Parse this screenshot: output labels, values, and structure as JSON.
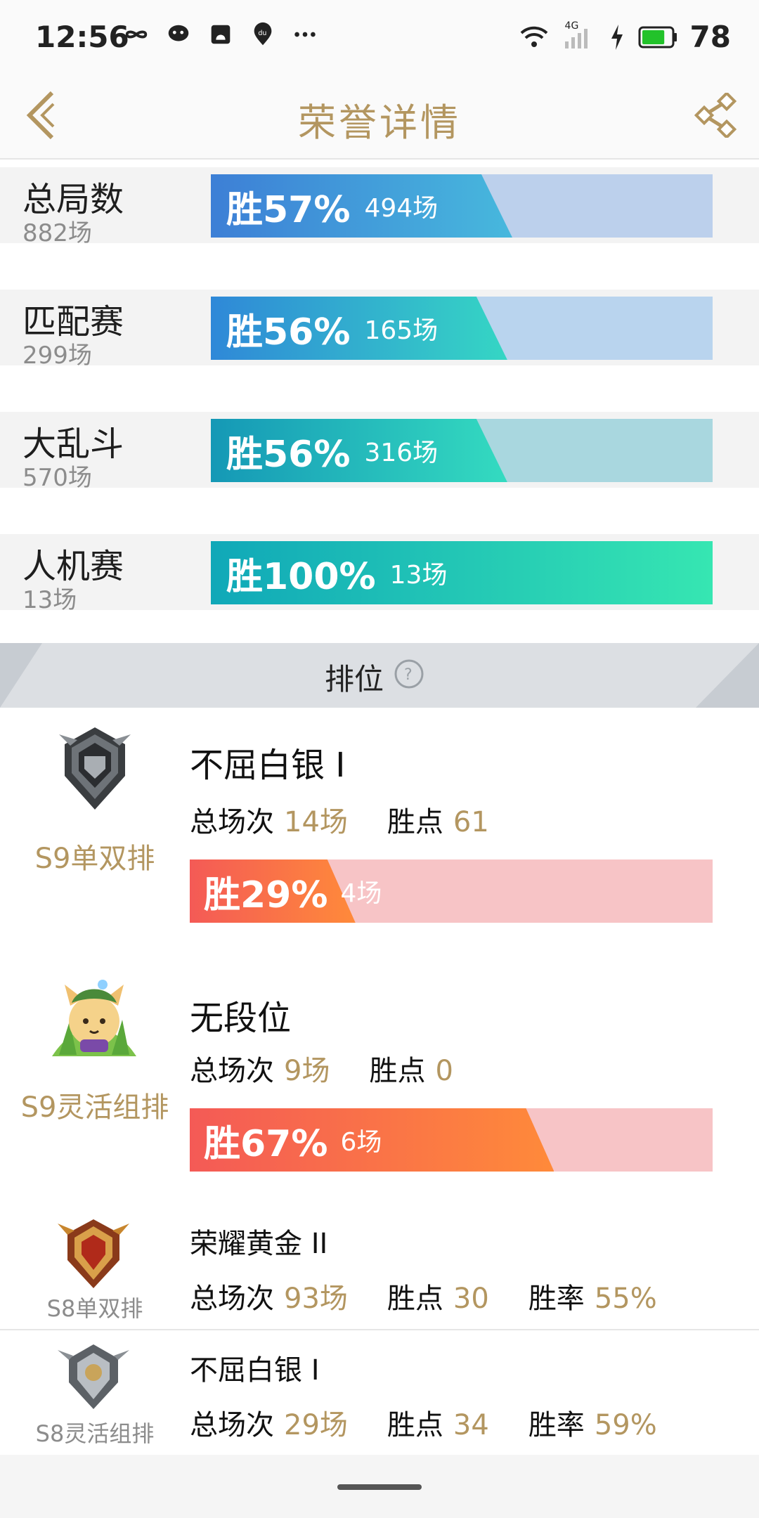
{
  "status_bar": {
    "time": "12:56",
    "network": "4G",
    "battery": "78",
    "colors": {
      "battery_fill": "#22c22a"
    },
    "left_icons": [
      "infinity-icon",
      "chat-icon",
      "notification-icon",
      "du-icon",
      "more-dots-icon"
    ]
  },
  "header": {
    "title": "荣誉详情",
    "back_icon": "back-chevron-icon",
    "share_icon": "share-icon",
    "accent_color": "#b39660"
  },
  "stats": [
    {
      "name": "总局数",
      "count": "882场",
      "win_pct_label": "胜57%",
      "wins": "494场",
      "win_fraction": 0.57,
      "grad_start": "#3d7fd6",
      "grad_end": "#47b8dd",
      "track": "#bcd0ec"
    },
    {
      "name": "匹配赛",
      "count": "299场",
      "win_pct_label": "胜56%",
      "wins": "165场",
      "win_fraction": 0.56,
      "grad_start": "#2f88d8",
      "grad_end": "#35d6c4",
      "track": "#b9d4ee"
    },
    {
      "name": "大乱斗",
      "count": "570场",
      "win_pct_label": "胜56%",
      "wins": "316场",
      "win_fraction": 0.56,
      "grad_start": "#1598b6",
      "grad_end": "#34dbc0",
      "track": "#a9d7df"
    },
    {
      "name": "人机赛",
      "count": "13场",
      "win_pct_label": "胜100%",
      "wins": "13场",
      "win_fraction": 1.0,
      "grad_start": "#10a8b8",
      "grad_end": "#36e6b2",
      "track": "#a9e6dc"
    }
  ],
  "ranked_section": {
    "title": "排位",
    "help_icon": "question-circle-icon"
  },
  "ranked": [
    {
      "queue": "S9单双排",
      "tier": "不屈白银 I",
      "emblem": "silver-emblem-icon",
      "total_label": "总场次",
      "total": "14场",
      "lp_label": "胜点",
      "lp": "61",
      "win_pct_label": "胜29%",
      "wins": "4场",
      "win_fraction": 0.29
    },
    {
      "queue": "S9灵活组排",
      "tier": "无段位",
      "emblem": "teemo-unranked-icon",
      "total_label": "总场次",
      "total": "9场",
      "lp_label": "胜点",
      "lp": "0",
      "win_pct_label": "胜67%",
      "wins": "6场",
      "win_fraction": 0.67
    },
    {
      "queue": "S8单双排",
      "tier": "荣耀黄金 II",
      "emblem": "gold-emblem-icon",
      "total_label": "总场次",
      "total": "93场",
      "lp_label": "胜点",
      "lp": "30",
      "rate_label": "胜率",
      "rate": "55%"
    },
    {
      "queue": "S8灵活组排",
      "tier": "不屈白银 I",
      "emblem": "silver-emblem-small-icon",
      "total_label": "总场次",
      "total": "29场",
      "lp_label": "胜点",
      "lp": "34",
      "rate_label": "胜率",
      "rate": "59%"
    }
  ]
}
